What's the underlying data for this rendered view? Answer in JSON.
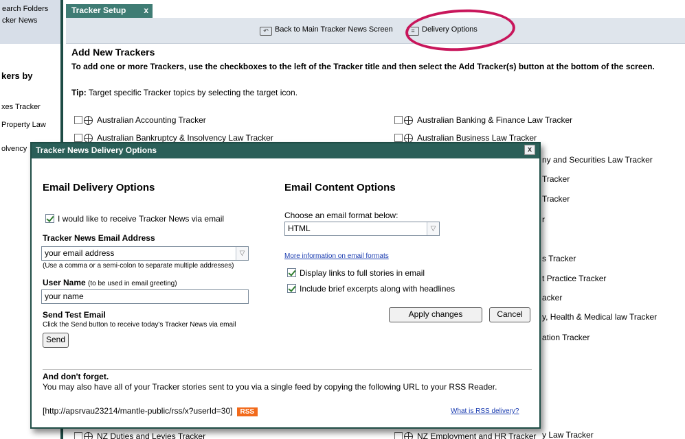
{
  "sidebar": {
    "links": [
      "earch Folders",
      "cker News"
    ],
    "heading": "kers by",
    "items": [
      "xes Tracker",
      "Property Law",
      "olvency"
    ]
  },
  "tab": {
    "label": "Tracker Setup",
    "close": "x"
  },
  "topnav": {
    "back_label": "Back to Main Tracker News Screen",
    "delivery_label": "Delivery Options"
  },
  "add": {
    "title": "Add New Trackers",
    "description": "To add one or more Trackers, use the checkboxes to the left of the Tracker title and then select the Add Tracker(s) button at the bottom of the screen.",
    "tip_label": "Tip:",
    "tip_text": " Target specific Tracker topics by selecting the target icon."
  },
  "trackers_left": [
    "Australian Accounting Tracker",
    "Australian Bankruptcy & Insolvency Law Tracker",
    "NZ Duties and Levies Tracker"
  ],
  "trackers_right": [
    "Australian Banking & Finance Law Tracker",
    "Australian Business Law Tracker",
    "NZ Employment and HR Tracker"
  ],
  "trackers_right_partial": [
    "ny and Securities Law Tracker",
    "Tracker",
    "Tracker",
    "r",
    "s Tracker",
    "t Practice Tracker",
    "acker",
    "y, Health & Medical law Tracker",
    "ation Tracker",
    "y Law Tracker"
  ],
  "modal": {
    "title": "Tracker News Delivery Options",
    "close": "x",
    "email_section": {
      "title": "Email Delivery Options",
      "receive_label": "I would like to receive Tracker News via email",
      "email_label": "Tracker News Email Address",
      "email_value": "your email address",
      "email_hint": "(Use a comma or a semi-colon to separate multiple addresses)",
      "user_label": "User Name",
      "user_hint": "(to be used in email greeting)",
      "user_value": "your name",
      "test_label": "Send Test Email",
      "test_hint": "Click the Send button to receive today's Tracker News via email",
      "send_button": "Send"
    },
    "content_section": {
      "title": "Email Content Options",
      "format_label": "Choose an email format below:",
      "format_value": "HTML",
      "format_link": "More information on email formats",
      "opt_links": "Display links to full stories in email",
      "opt_excerpts": "Include brief excerpts along with headlines",
      "apply_button": "Apply changes",
      "cancel_button": "Cancel"
    },
    "footer": {
      "title": "And don't forget.",
      "text": "You may also have all of your Tracker stories sent to you via a single feed by copying the following URL to your RSS Reader.",
      "url": "[http://apsrvau23214/mantle-public/rss/x?userId=30]",
      "rss_badge": "RSS",
      "rss_link": "What is RSS delivery?"
    }
  },
  "colors": {
    "accent": "#2a5f58",
    "highlight": "#c8165b",
    "rss": "#f26a1b"
  }
}
